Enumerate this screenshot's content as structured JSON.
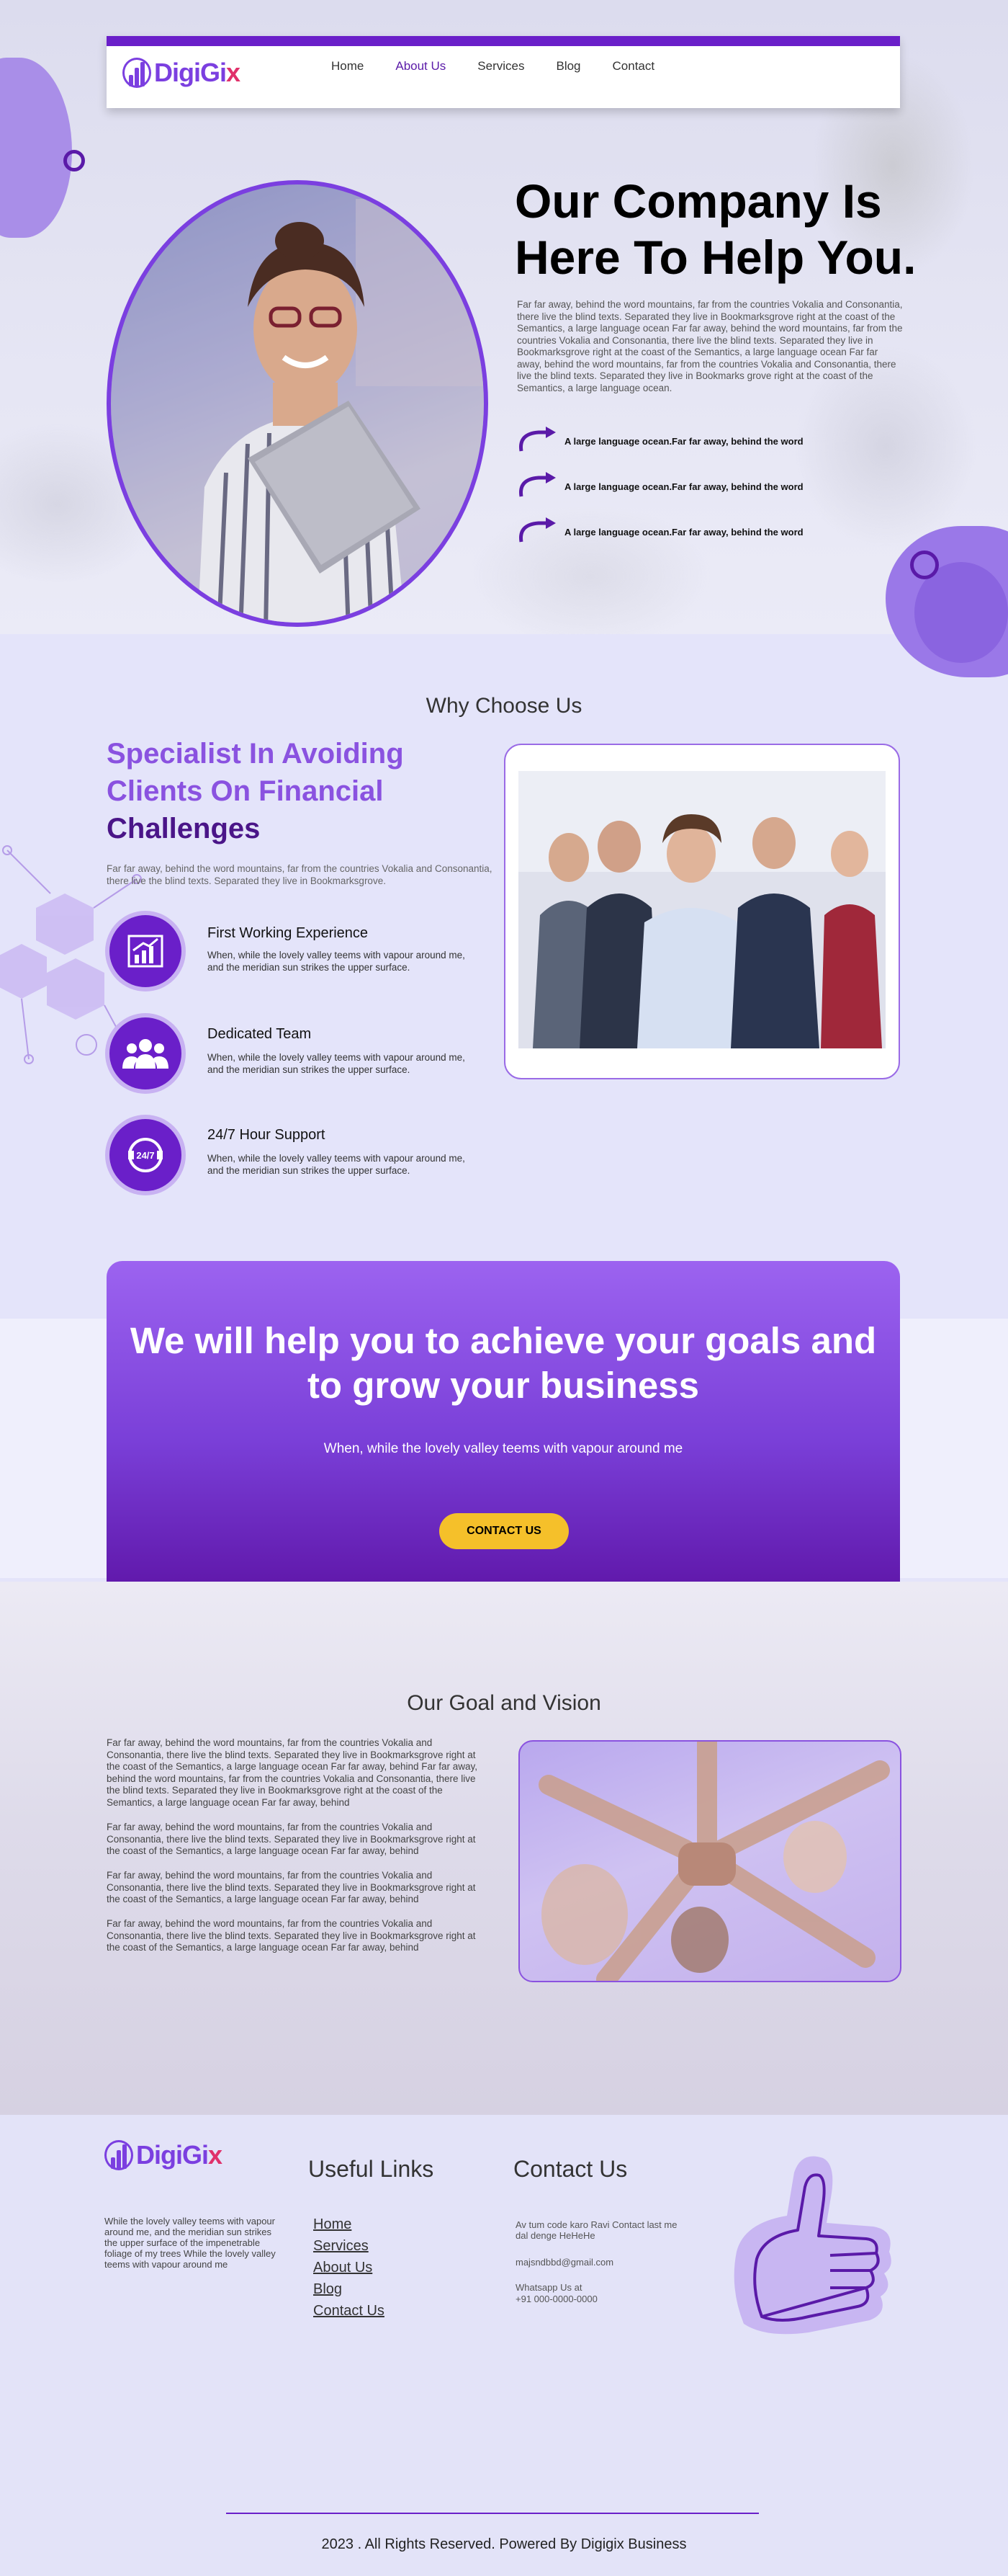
{
  "brand": {
    "name_main": "DigiGi",
    "name_accent": "x"
  },
  "nav": {
    "items": [
      {
        "label": "Home",
        "active": false
      },
      {
        "label": "About Us",
        "active": true
      },
      {
        "label": "Services",
        "active": false
      },
      {
        "label": "Blog",
        "active": false
      },
      {
        "label": "Contact",
        "active": false
      }
    ]
  },
  "hero": {
    "title_line1": "Our Company Is",
    "title_line2": "Here To Help You.",
    "paragraph": "Far far away, behind the word mountains, far from the countries Vokalia and Consonantia, there live the blind texts. Separated they live in Bookmarksgrove right at the coast of the Semantics, a large language ocean Far far away, behind the word mountains, far from the countries Vokalia and Consonantia, there live the blind texts. Separated they live in Bookmarksgrove right at the coast of the Semantics, a large language ocean Far far away, behind the word mountains, far from the countries Vokalia and Consonantia, there live the blind texts. Separated they live in Bookmarks grove right at the coast of the Semantics, a large language ocean.",
    "points": [
      "A large language ocean.Far far away, behind the word",
      "A large language ocean.Far far away, behind the word",
      "A large language ocean.Far far away, behind the word"
    ]
  },
  "why": {
    "section_title": "Why Choose Us",
    "heading_line1": "Specialist In Avoiding",
    "heading_line2": "Clients On Financial",
    "heading_line3": "Challenges",
    "paragraph": "Far far away, behind the word mountains, far from the countries Vokalia and Consonantia, there live the blind texts. Separated they live in Bookmarksgrove.",
    "features": [
      {
        "title": "First Working Experience",
        "desc": "When, while the lovely valley teems with vapour around me, and the meridian sun strikes the upper surface.",
        "icon": "growth-chart-icon"
      },
      {
        "title": "Dedicated Team",
        "desc": "When, while the lovely valley teems with vapour around me, and the meridian sun strikes the upper surface.",
        "icon": "team-icon"
      },
      {
        "title": "24/7 Hour Support",
        "desc": "When, while the lovely valley teems with vapour around me, and the meridian sun strikes the upper surface.",
        "icon": "support-24-7-icon",
        "icon_text": "24/7"
      }
    ]
  },
  "cta": {
    "title_line1": "We will help you to achieve your goals and",
    "title_line2": "to grow your business",
    "subtitle": "When, while the lovely valley teems with vapour around me",
    "button_label": "CONTACT US"
  },
  "goal": {
    "section_title": "Our Goal and Vision",
    "paragraphs": [
      "Far far away, behind the word mountains, far from the countries Vokalia and Consonantia, there live the blind texts. Separated they live in Bookmarksgrove right at the coast of the Semantics, a large language ocean Far far away, behind Far far away, behind the word mountains, far from the countries Vokalia and Consonantia, there live the blind texts. Separated they live in Bookmarksgrove right at the coast of the Semantics, a large language ocean Far far away, behind",
      "Far far away, behind the word mountains, far from the countries Vokalia and Consonantia, there live the blind texts. Separated they live in Bookmarksgrove right at the coast of the Semantics, a large language ocean Far far away, behind",
      "Far far away, behind the word mountains, far from the countries Vokalia and Consonantia, there live the blind texts. Separated they live in Bookmarksgrove right at the coast of the Semantics, a large language ocean Far far away, behind",
      "Far far away, behind the word mountains, far from the countries Vokalia and Consonantia, there live the blind texts. Separated they live in Bookmarksgrove right at the coast of the Semantics, a large language ocean Far far away, behind"
    ]
  },
  "footer": {
    "description": "While the lovely valley teems with vapour around me, and the meridian sun strikes the upper surface of the impenetrable foliage of my trees While the lovely valley teems with vapour around me",
    "links_title": "Useful Links",
    "links": [
      "Home",
      "Services",
      "About Us",
      "Blog",
      "Contact Us"
    ],
    "contact_title": "Contact Us",
    "contact_line1": "Av tum code karo Ravi Contact last me dal denge HeHeHe",
    "email": "majsndbbd@gmail.com",
    "whatsapp_label": "Whatsapp Us at",
    "phone": "+91 000-0000-0000",
    "copyright": "2023 . All Rights Reserved. Powered By Digigix Business"
  },
  "colors": {
    "primary": "#6a1fc9",
    "light_purple": "#8a52e0",
    "accent_yellow": "#f5c02a",
    "background": "#e4e4fa"
  }
}
